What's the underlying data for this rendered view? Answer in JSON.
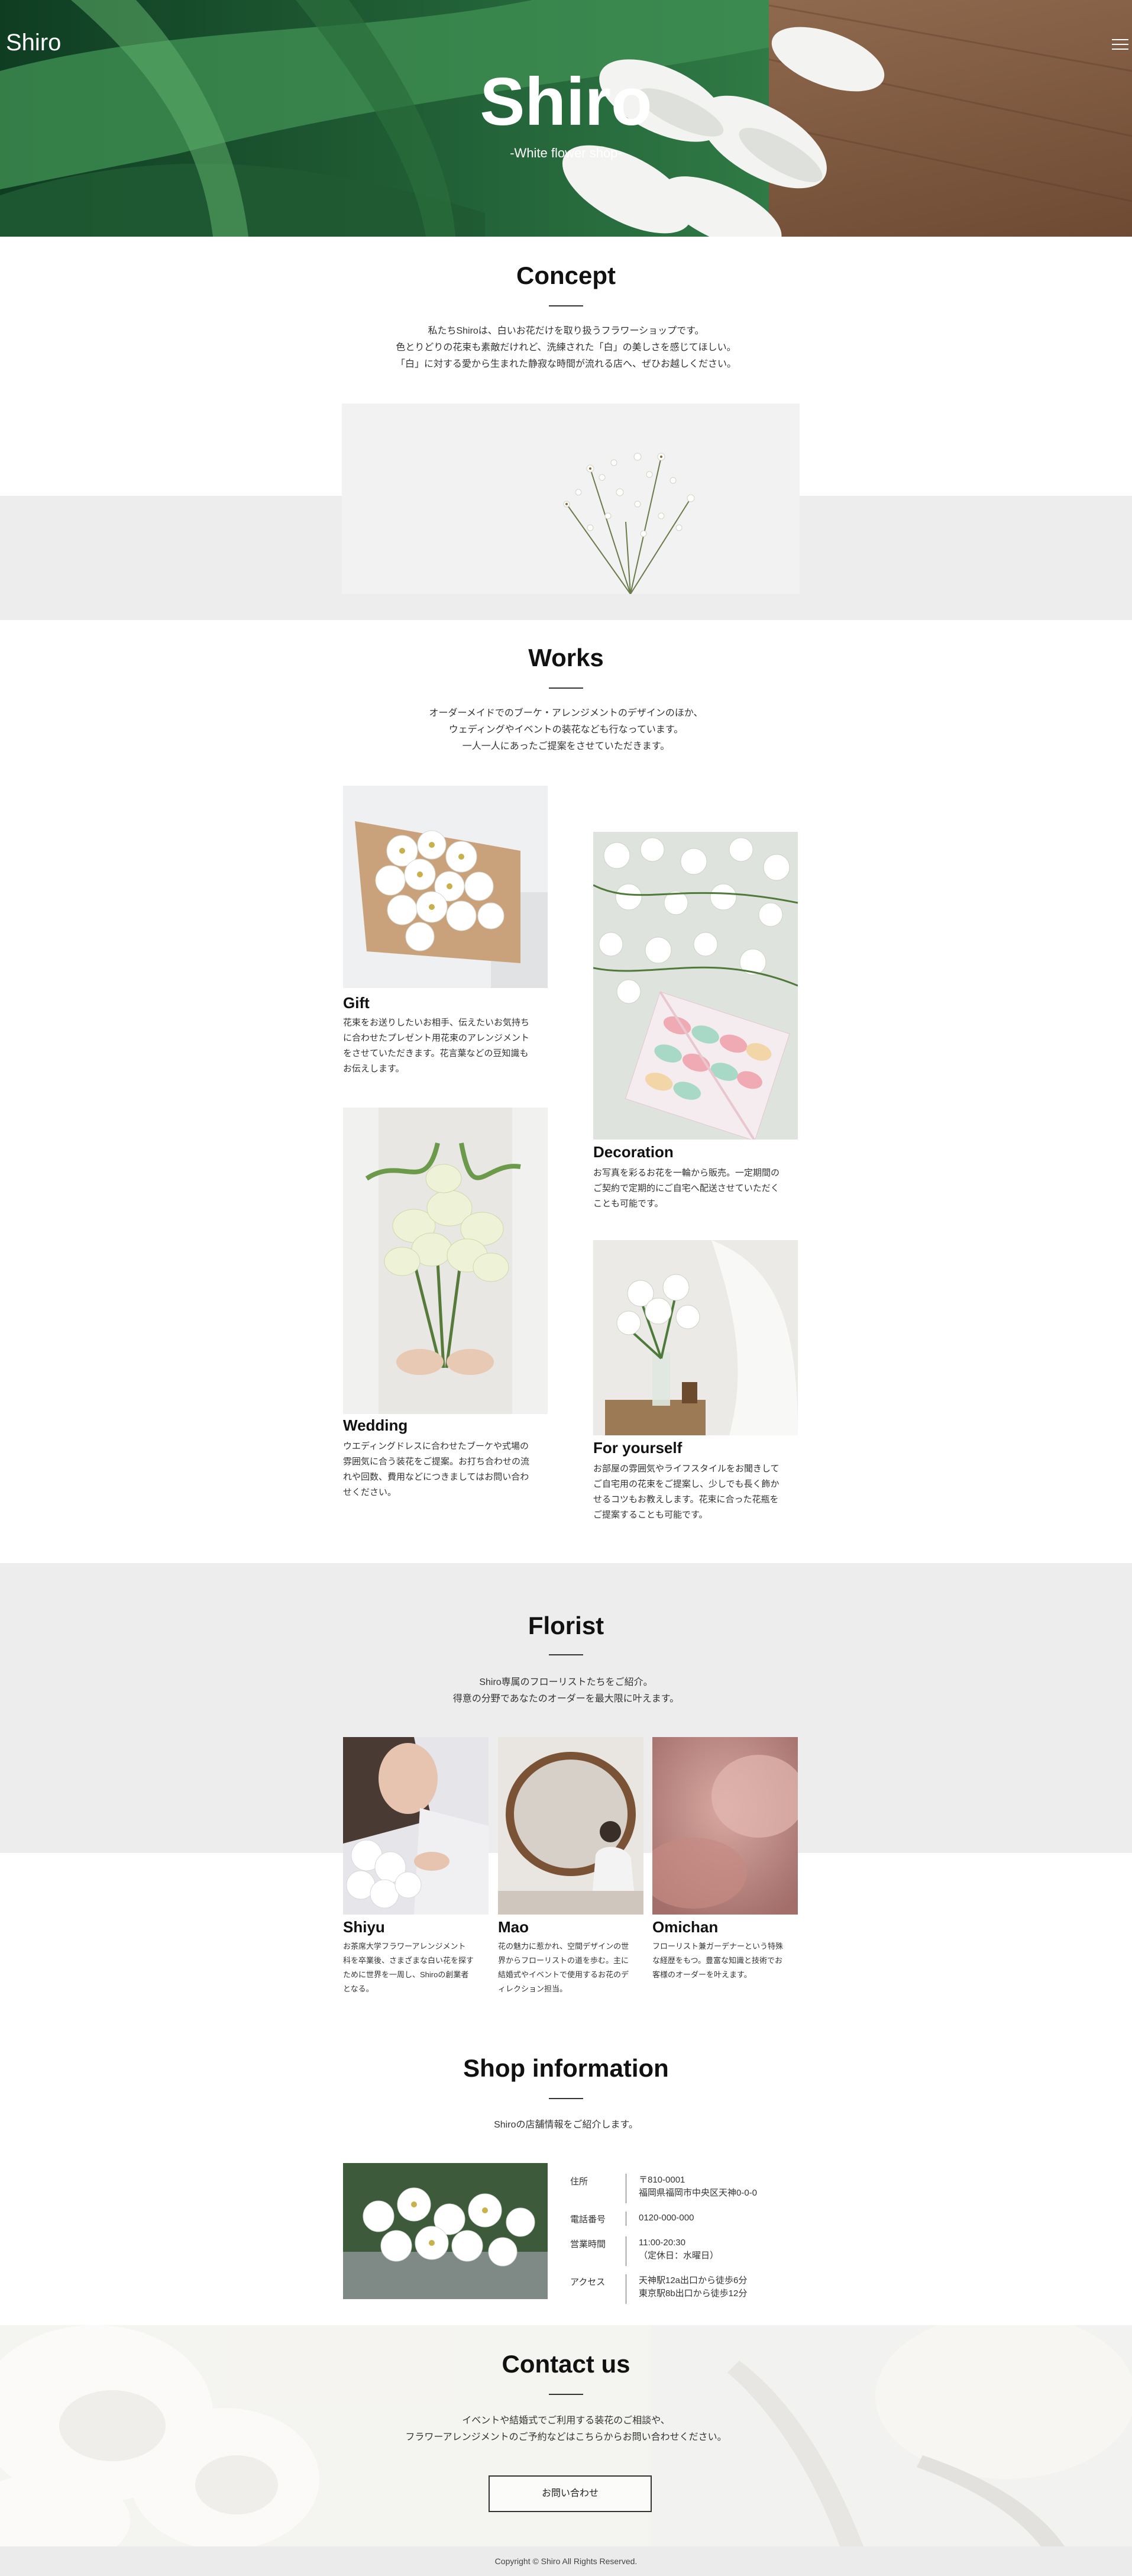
{
  "header": {
    "logo": "Shiro",
    "menu_icon": "hamburger-menu-icon",
    "hero_title": "Shiro",
    "hero_subtitle": "-White flower shop-"
  },
  "concept": {
    "title": "Concept",
    "lines": [
      "私たちShiroは、白いお花だけを取り扱うフラワーショップです。",
      "色とりどりの花束も素敵だけれど、洗練された「白」の美しさを感じてほしい。",
      "「白」に対する愛から生まれた静寂な時間が流れる店へ、ぜひお越しください。"
    ]
  },
  "works": {
    "title": "Works",
    "lines": [
      "オーダーメイドでのブーケ・アレンジメントのデザインのほか、",
      "ウェディングやイベントの装花なども行なっています。",
      "一人一人にあったご提案をさせていただきます。"
    ],
    "items": [
      {
        "title": "Gift",
        "lines": [
          "花束をお送りしたいお相手、伝えたいお気持ち",
          "に合わせたプレゼント用花束のアレンジメント",
          "をさせていただきます。花言葉などの豆知識も",
          "お伝えします。"
        ]
      },
      {
        "title": "Decoration",
        "lines": [
          "お写真を彩るお花を一輪から販売。一定期間の",
          "ご契約で定期的にご自宅へ配送させていただく",
          "ことも可能です。"
        ]
      },
      {
        "title": "Wedding",
        "lines": [
          "ウエディングドレスに合わせたブーケや式場の",
          "雰囲気に合う装花をご提案。お打ち合わせの流",
          "れや回数、費用などにつきましてはお問い合わ",
          "せください。"
        ]
      },
      {
        "title": "For yourself",
        "lines": [
          "お部屋の雰囲気やライフスタイルをお聞きして",
          "ご自宅用の花束をご提案し、少しでも長く飾か",
          "せるコツもお教えします。花束に合った花瓶を",
          "ご提案することも可能です。"
        ]
      }
    ]
  },
  "florist": {
    "title": "Florist",
    "lines": [
      "Shiro専属のフローリストたちをご紹介。",
      "得意の分野であなたのオーダーを最大限に叶えます。"
    ],
    "members": [
      {
        "name": "Shiyu",
        "lines": [
          "お茶席大学フラワーアレンジメント",
          "科を卒業後、さまざまな白い花を探す",
          "ために世界を一周し、Shiroの創業者",
          "となる。"
        ]
      },
      {
        "name": "Mao",
        "lines": [
          "花の魅力に惹かれ、空間デザインの世",
          "界からフローリストの道を歩む。主に",
          "結婚式やイベントで使用するお花のデ",
          "ィレクション担当。"
        ]
      },
      {
        "name": "Omichan",
        "lines": [
          "フローリスト兼ガーデナーという特殊",
          "な経歴をもつ。豊富な知識と技術でお",
          "客様のオーダーを叶えます。"
        ]
      }
    ]
  },
  "shop": {
    "title": "Shop information",
    "intro": "Shiroの店舗情報をご紹介します。",
    "rows": [
      {
        "label": "住所",
        "lines": [
          "〒810-0001",
          "福岡県福岡市中央区天神0-0-0"
        ]
      },
      {
        "label": "電話番号",
        "lines": [
          "0120-000-000"
        ]
      },
      {
        "label": "営業時間",
        "lines": [
          "11:00-20:30",
          "（定休日：水曜日）"
        ]
      },
      {
        "label": "アクセス",
        "lines": [
          "天神駅12a出口から徒歩6分",
          "東京駅8b出口から徒歩12分"
        ]
      }
    ]
  },
  "contact": {
    "title": "Contact us",
    "lines": [
      "イベントや結婚式でご利用する装花のご相談や、",
      "フラワーアレンジメントのご予約などはこちらからお問い合わせください。"
    ],
    "button_label": "お問い合わせ"
  },
  "footer": {
    "copyright": "Copyright © Shiro All Rights Reserved."
  }
}
